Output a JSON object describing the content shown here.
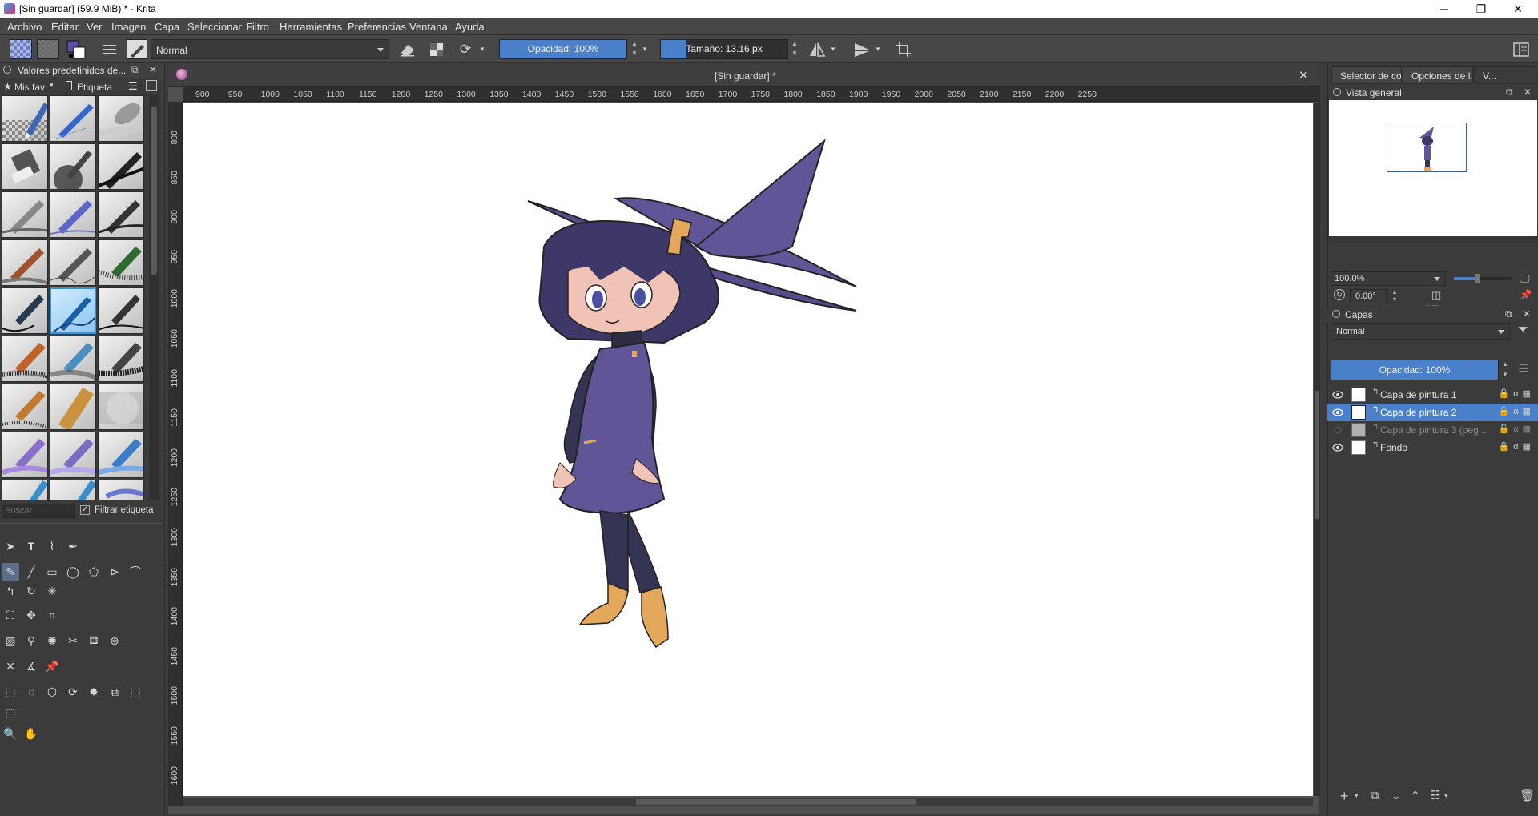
{
  "window": {
    "title": "[Sin guardar]  (59.9 MiB)  * - Krita",
    "minimize": "─",
    "maximize": "❐",
    "close": "✕"
  },
  "menu": [
    "Archivo",
    "Editar",
    "Ver",
    "Imagen",
    "Capa",
    "Seleccionar",
    "Filtro",
    "Herramientas",
    "Preferencias",
    "Ventana",
    "Ayuda"
  ],
  "toolbar": {
    "blend_mode": "Normal",
    "opacity": {
      "label": "Opacidad: 100%",
      "fraction": 1.0
    },
    "size": {
      "label": "Tamaño: 13.16 px",
      "fraction": 0.2
    }
  },
  "brush_presets": {
    "title": "Valores predefinidos de...",
    "tag": "Mis fav",
    "tag_label": "Etiqueta",
    "search_placeholder": "Buscar",
    "filter_label": "Filtrar etiqueta"
  },
  "document": {
    "tab_title": "[Sin guardar]  *",
    "ruler_h": [
      "900",
      "950",
      "1000",
      "1050",
      "1100",
      "1150",
      "1200",
      "1250",
      "1300",
      "1350",
      "1400",
      "1450",
      "1500",
      "1550",
      "1600",
      "1650",
      "1700",
      "1750",
      "1800",
      "1850",
      "1900",
      "1950",
      "2000",
      "2050",
      "2100",
      "2150",
      "2200",
      "2250"
    ],
    "ruler_v": [
      "800",
      "850",
      "900",
      "950",
      "1000",
      "1050",
      "1100",
      "1150",
      "1200",
      "1250",
      "1300",
      "1350",
      "1400",
      "1450",
      "1500",
      "1550",
      "1600"
    ]
  },
  "right_tabs": [
    "Selector de co...",
    "Opciones de l...",
    "V..."
  ],
  "overview": {
    "title": "Vista general",
    "zoom": "100.0%",
    "rotation": "0.00°"
  },
  "layers": {
    "title": "Capas",
    "blend_mode": "Normal",
    "opacity": {
      "label": "Opacidad:  100%",
      "fraction": 1.0
    },
    "items": [
      {
        "name": "Capa de pintura 1",
        "visible": true,
        "selected": false
      },
      {
        "name": "Capa de pintura 2",
        "visible": true,
        "selected": true
      },
      {
        "name": "Capa de pintura 3 (peg...",
        "visible": false,
        "selected": false
      },
      {
        "name": "Fondo",
        "visible": true,
        "selected": false
      }
    ]
  },
  "colors": {
    "accent": "#4a7fc9",
    "hat_purple": "#5f5597",
    "hair_navy": "#3d3868",
    "boot_tan": "#e3a85b",
    "skin": "#f0c3b6"
  }
}
